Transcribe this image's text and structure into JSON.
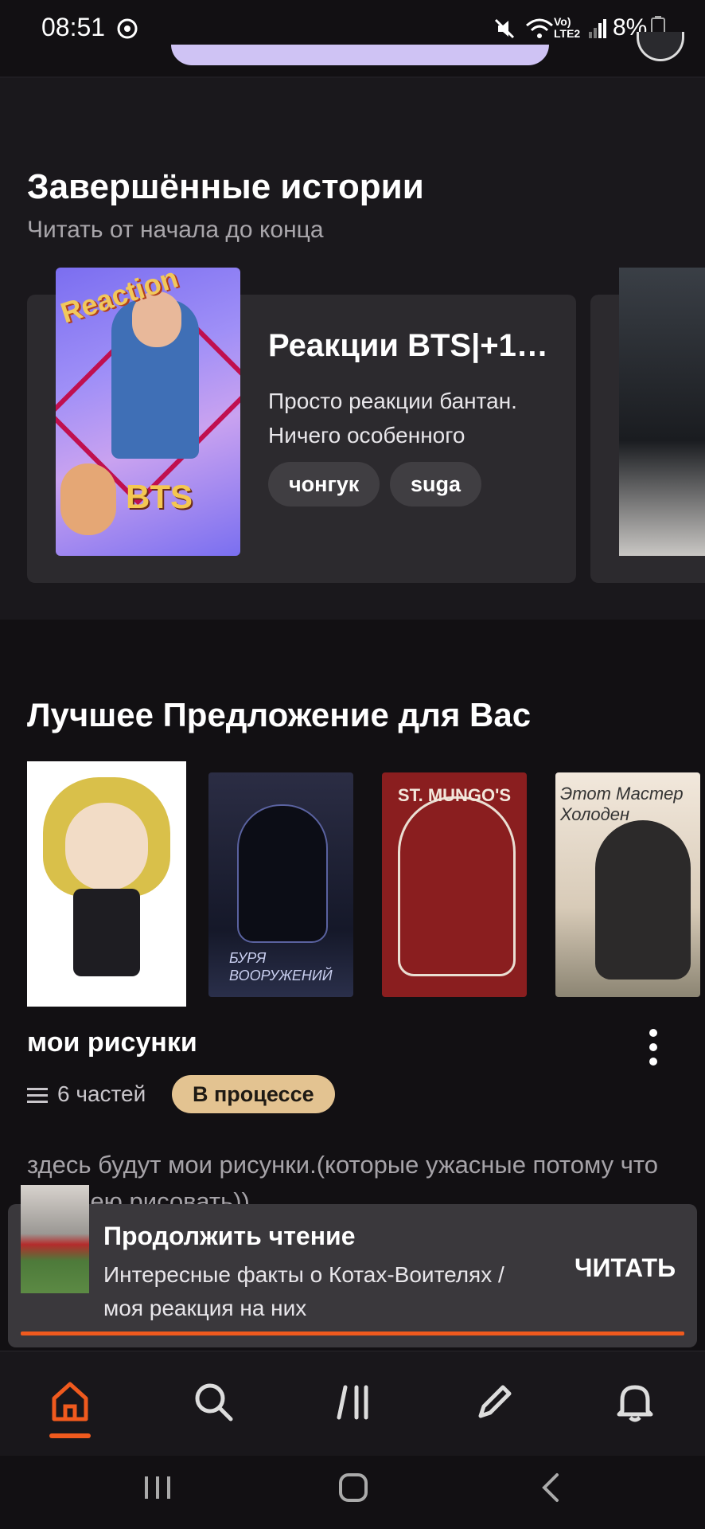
{
  "status_bar": {
    "time": "08:51",
    "battery": "8%",
    "network": "Vo) LTE2"
  },
  "completed": {
    "title": "Завершённые истории",
    "subtitle": "Читать от начала до конца",
    "card": {
      "cover_text_top": "Reaction",
      "cover_text_bottom": "BTS",
      "title": "Реакции BTS|+1…",
      "description": "Просто реакции бантан. Ничего особенного",
      "tags": [
        "чонгук",
        "suga"
      ]
    }
  },
  "recommend": {
    "title": "Лучшее Предложение для Вас",
    "thumbs": {
      "t2_label": "БУРЯ ВООРУЖЕНИЙ",
      "t3_label": "ST. MUNGO'S",
      "t4_label": "Этот Мастер Холоден"
    },
    "book": {
      "title": "мои рисунки",
      "parts": "6 частей",
      "status": "В процессе",
      "description": "здесь будут мои рисунки.(которые ужасные потому что не умею рисовать))"
    }
  },
  "continue_reading": {
    "title": "Продолжить чтение",
    "subtitle": "Интересные факты о Котах-Воителях / моя реакция на них",
    "button": "ЧИТАТЬ"
  },
  "bottom_nav": {
    "items": [
      "home-icon",
      "search-icon",
      "library-icon",
      "write-icon",
      "notifications-icon"
    ],
    "active": "home",
    "accent": "#f05a1e"
  }
}
